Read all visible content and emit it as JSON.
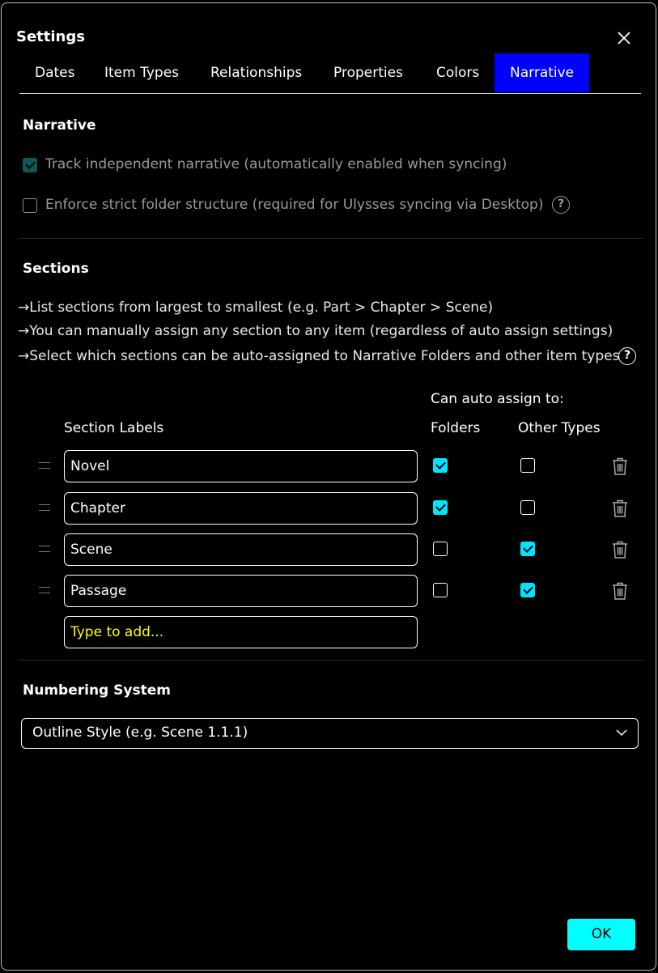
{
  "dialog": {
    "title": "Settings"
  },
  "tabs": [
    "Dates",
    "Item Types",
    "Relationships",
    "Properties",
    "Colors",
    "Narrative"
  ],
  "active_tab": "Narrative",
  "narrative": {
    "heading": "Narrative",
    "track_label": "Track independent narrative (automatically enabled when syncing)",
    "track_checked": true,
    "strict_label": "Enforce strict folder structure (required for Ulysses syncing via Desktop)",
    "strict_checked": false,
    "help_glyph": "?"
  },
  "sections": {
    "heading": "Sections",
    "bullets": [
      "List sections from largest to smallest (e.g. Part > Chapter > Scene)",
      "You can manually assign any section to any item (regardless of auto assign settings)",
      "Select which sections can be auto-assigned to Narrative Folders and other item types"
    ],
    "can_auto_assign": "Can auto assign to:",
    "col_labels": "Section Labels",
    "col_folders": "Folders",
    "col_other": "Other Types",
    "rows": [
      {
        "label": "Novel",
        "folders": true,
        "other": false
      },
      {
        "label": "Chapter",
        "folders": true,
        "other": false
      },
      {
        "label": "Scene",
        "folders": false,
        "other": true
      },
      {
        "label": "Passage",
        "folders": false,
        "other": true
      }
    ],
    "add_placeholder": "Type to add..."
  },
  "numbering": {
    "heading": "Numbering System",
    "selected": "Outline Style (e.g. Scene 1.1.1)"
  },
  "ok_label": "OK",
  "colors": {
    "accent": "#00ffff",
    "active_tab": "#0000ff",
    "placeholder": "#ffff00"
  }
}
